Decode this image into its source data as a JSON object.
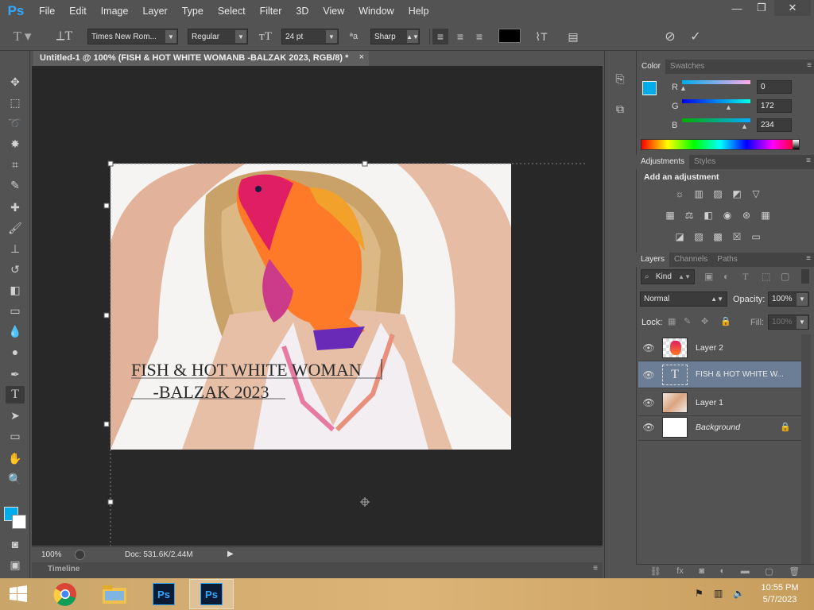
{
  "app": {
    "logo": "Ps"
  },
  "menu": [
    "File",
    "Edit",
    "Image",
    "Layer",
    "Type",
    "Select",
    "Filter",
    "3D",
    "View",
    "Window",
    "Help"
  ],
  "window_controls": {
    "minimize": "—",
    "restore": "❐",
    "close": "✕"
  },
  "options": {
    "font_family": "Times New Rom...",
    "font_style": "Regular",
    "font_size": "24 pt",
    "aa_icon": "ªa",
    "antialias": "Sharp",
    "text_color": "#000000"
  },
  "document": {
    "tab_title": "Untitled-1 @ 100% (FISH & HOT WHITE WOMANB  -BALZAK 2023, RGB/8) *",
    "tab_close": "×",
    "text_line1": "FISH & HOT WHITE WOMAN",
    "text_line2": "     -BALZAK 2023",
    "zoom": "100%",
    "doc_info": "Doc: 531.6K/2.44M"
  },
  "timeline": {
    "label": "Timeline"
  },
  "color_panel": {
    "tabs": [
      "Color",
      "Swatches"
    ],
    "r_label": "R",
    "g_label": "G",
    "b_label": "B",
    "r": "0",
    "g": "172",
    "b": "234",
    "fg_color": "#00acea",
    "bg_color": "#ffffff"
  },
  "adjustments_panel": {
    "tabs": [
      "Adjustments",
      "Styles"
    ],
    "heading": "Add an adjustment"
  },
  "layers_panel": {
    "tabs": [
      "Layers",
      "Channels",
      "Paths"
    ],
    "filter_kind": "Kind",
    "blend_mode": "Normal",
    "opacity_label": "Opacity:",
    "opacity": "100%",
    "lock_label": "Lock:",
    "fill_label": "Fill:",
    "fill": "100%",
    "layers": [
      {
        "name": "Layer 2",
        "kind": "image"
      },
      {
        "name": "FISH & HOT WHITE W...",
        "kind": "text",
        "thumb_text": "T",
        "selected": true
      },
      {
        "name": "Layer 1",
        "kind": "image"
      },
      {
        "name": "Background",
        "kind": "background"
      }
    ]
  },
  "taskbar": {
    "time": "10:55 PM",
    "date": "5/7/2023"
  }
}
